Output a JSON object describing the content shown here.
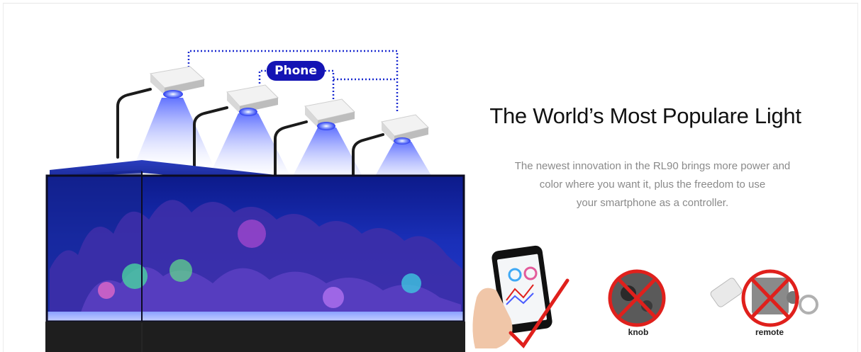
{
  "banner": {
    "badge_label": "Phone",
    "headline": "The World’s Most Populare Light",
    "description_lines": [
      "The newest innovation in the RL90 brings more power and",
      "color where you want it, plus the freedom to use",
      "your smartphone as a controller."
    ],
    "options": [
      {
        "label": "knob",
        "icon": "knob-crossed-icon"
      },
      {
        "label": "remote",
        "icon": "remote-crossed-icon"
      }
    ],
    "colors": {
      "badge": "#1414b4",
      "led": "#4a5cff",
      "cross": "#e0201c",
      "headline": "#111111",
      "description": "#8a8a8a"
    }
  }
}
